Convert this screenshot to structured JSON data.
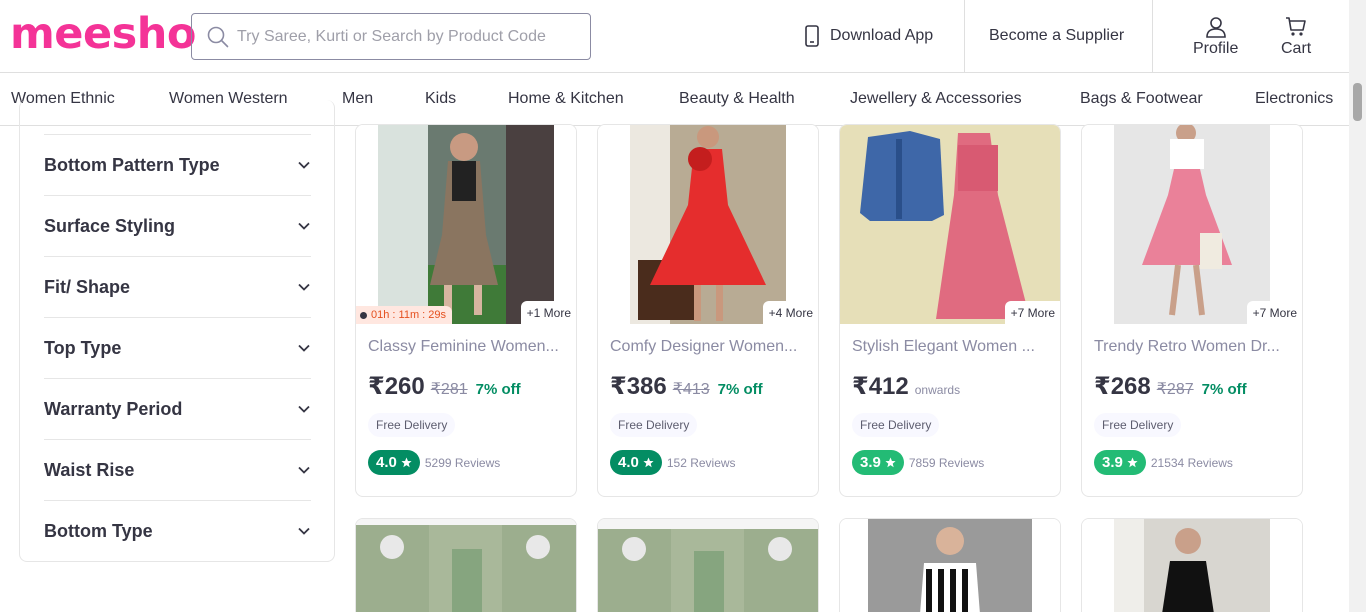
{
  "brand": {
    "logo": "meesho",
    "color": "#f43397"
  },
  "search": {
    "placeholder": "Try Saree, Kurti or Search by Product Code"
  },
  "header": {
    "download_app": "Download App",
    "become_supplier": "Become a Supplier",
    "profile": "Profile",
    "cart": "Cart"
  },
  "nav": {
    "categories": [
      "Women Ethnic",
      "Women Western",
      "Men",
      "Kids",
      "Home & Kitchen",
      "Beauty & Health",
      "Jewellery & Accessories",
      "Bags & Footwear",
      "Electronics"
    ]
  },
  "filters": [
    "Bottom Pattern Type",
    "Surface Styling",
    "Fit/ Shape",
    "Top Type",
    "Warranty Period",
    "Waist Rise",
    "Bottom Type"
  ],
  "products": [
    {
      "title": "Classy Feminine Women...",
      "price": "₹260",
      "mrp": "₹281",
      "off": "7% off",
      "onwards": "",
      "delivery": "Free Delivery",
      "rating": "4.0",
      "rating_color": "#038d63",
      "reviews": "5299 Reviews",
      "more": "+1 More",
      "timer": "01h : 11m : 29s"
    },
    {
      "title": "Comfy Designer Women...",
      "price": "₹386",
      "mrp": "₹413",
      "off": "7% off",
      "onwards": "",
      "delivery": "Free Delivery",
      "rating": "4.0",
      "rating_color": "#038d63",
      "reviews": "152 Reviews",
      "more": "+4 More",
      "timer": ""
    },
    {
      "title": "Stylish Elegant Women ...",
      "price": "₹412",
      "mrp": "",
      "off": "",
      "onwards": "onwards",
      "delivery": "Free Delivery",
      "rating": "3.9",
      "rating_color": "#23bb75",
      "reviews": "7859 Reviews",
      "more": "+7 More",
      "timer": ""
    },
    {
      "title": "Trendy Retro Women Dr...",
      "price": "₹268",
      "mrp": "₹287",
      "off": "7% off",
      "onwards": "",
      "delivery": "Free Delivery",
      "rating": "3.9",
      "rating_color": "#23bb75",
      "reviews": "21534 Reviews",
      "more": "+7 More",
      "timer": ""
    }
  ],
  "colors": {
    "text": "#353543",
    "muted": "#8b8ba3",
    "discount": "#038d63",
    "rating_high": "#038d63",
    "rating_mid": "#23bb75"
  }
}
